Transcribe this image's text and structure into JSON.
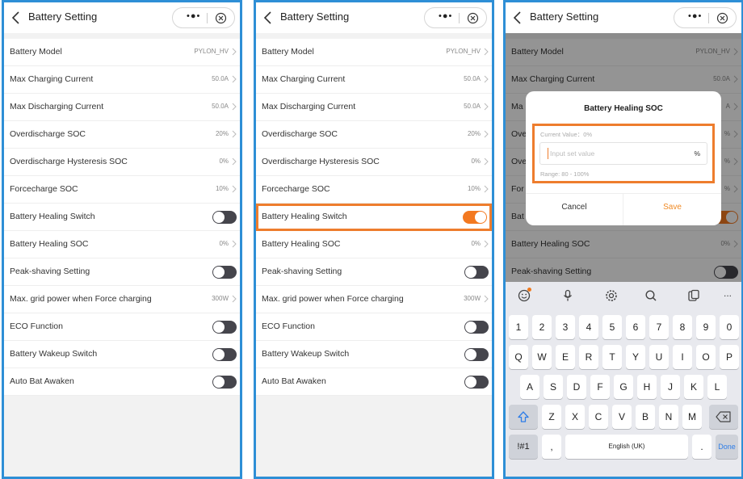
{
  "header": {
    "title": "Battery Setting",
    "more_icon": "•●•"
  },
  "rows": [
    {
      "label": "Battery Model",
      "value": "PYLON_HV"
    },
    {
      "label": "Max Charging Current",
      "value": "50.0A"
    },
    {
      "label": "Max Discharging Current",
      "value": "50.0A"
    },
    {
      "label": "Overdischarge SOC",
      "value": "20%"
    },
    {
      "label": "Overdischarge Hysteresis SOC",
      "value": "0%"
    },
    {
      "label": "Forcecharge SOC",
      "value": "10%"
    },
    {
      "label": "Battery Healing Switch"
    },
    {
      "label": "Battery Healing SOC",
      "value": "0%"
    },
    {
      "label": "Peak-shaving Setting"
    },
    {
      "label": "Max. grid power when Force charging",
      "value": "300W"
    },
    {
      "label": "ECO Function"
    },
    {
      "label": "Battery Wakeup Switch"
    },
    {
      "label": "Auto Bat Awaken"
    }
  ],
  "panel3": {
    "visible_labels": [
      "Battery Model",
      "Max Charging Current",
      "Ma",
      "Ove",
      "Ove",
      "For",
      "Bat",
      "Battery Healing SOC",
      "Peak-shaving Setting"
    ],
    "visible_values": [
      "PYLON_HV",
      "50.0A",
      "A",
      "%",
      "%",
      "%"
    ],
    "healing_soc_value": "0%"
  },
  "dialog": {
    "title": "Battery Healing SOC",
    "current_value": "Current Value：0%",
    "placeholder": "Input set value",
    "unit": "%",
    "range": "Range: 80 - 100%",
    "cancel": "Cancel",
    "save": "Save"
  },
  "keyboard": {
    "toolbar": [
      "emoji-icon",
      "microphone-icon",
      "settings-icon",
      "search-icon",
      "clipboard-icon",
      "more-icon"
    ],
    "more": "...",
    "row1": [
      "1",
      "2",
      "3",
      "4",
      "5",
      "6",
      "7",
      "8",
      "9",
      "0"
    ],
    "row2": [
      "Q",
      "W",
      "E",
      "R",
      "T",
      "Y",
      "U",
      "I",
      "O",
      "P"
    ],
    "row3": [
      "A",
      "S",
      "D",
      "F",
      "G",
      "H",
      "J",
      "K",
      "L"
    ],
    "row4": [
      "Z",
      "X",
      "C",
      "V",
      "B",
      "N",
      "M"
    ],
    "symbols": "!#1",
    "comma": ",",
    "space": "English (UK)",
    "period": ".",
    "done": "Done"
  },
  "colors": {
    "frame": "#2e8fd6",
    "highlight": "#ee7d2d",
    "toggle_on": "#f37920",
    "toggle_off": "#45454c",
    "save": "#f08a24",
    "done": "#2f7ee8"
  }
}
